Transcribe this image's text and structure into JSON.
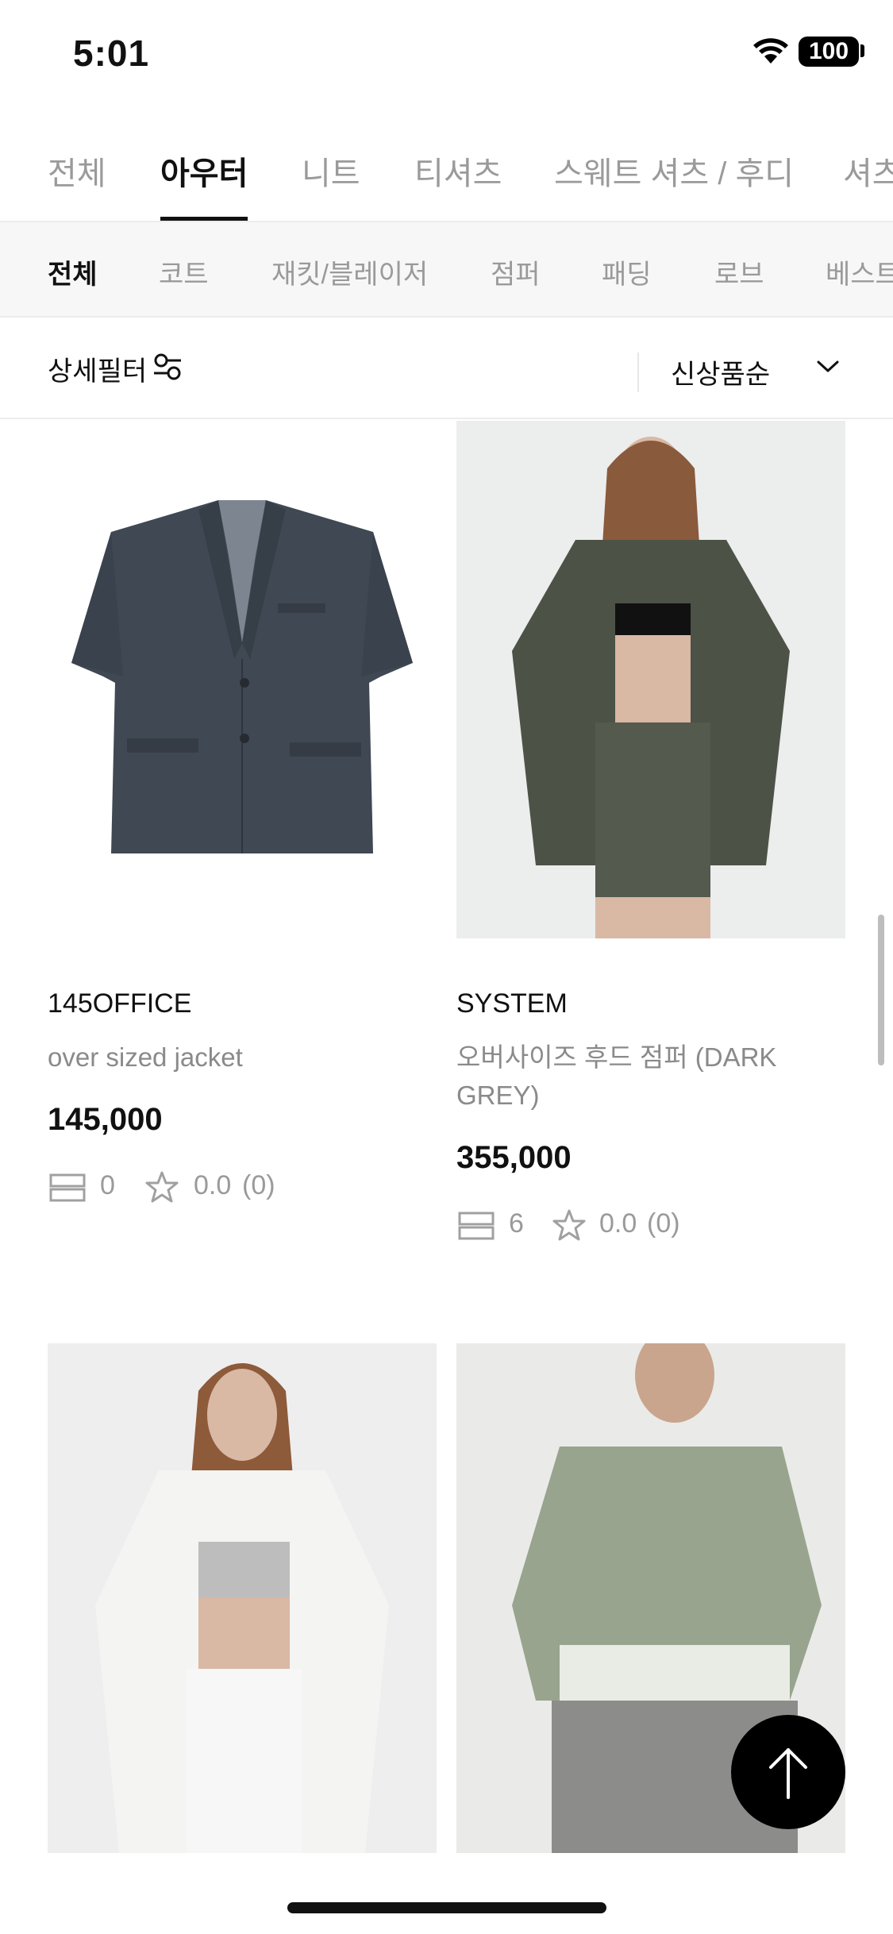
{
  "status": {
    "time": "5:01",
    "battery": "100"
  },
  "main_tabs": [
    "전체",
    "아우터",
    "니트",
    "티셔츠",
    "스웨트 셔츠 / 후디",
    "셔츠"
  ],
  "sub_tabs": [
    "전체",
    "코트",
    "재킷/블레이저",
    "점퍼",
    "패딩",
    "로브",
    "베스트"
  ],
  "filter": {
    "label": "상세필터",
    "sort": "신상품순"
  },
  "products": [
    {
      "brand": "145OFFICE",
      "name": "over sized jacket",
      "price": "145,000",
      "compare": "0",
      "rating": "0.0",
      "reviews": "(0)"
    },
    {
      "brand": "SYSTEM",
      "name": "오버사이즈 후드 점퍼 (DARK GREY)",
      "price": "355,000",
      "compare": "6",
      "rating": "0.0",
      "reviews": "(0)"
    }
  ],
  "colors": {
    "text": "#111111",
    "muted": "#9a9a9a",
    "divider": "#ececec",
    "subtab_bg": "#f7f7f7"
  }
}
